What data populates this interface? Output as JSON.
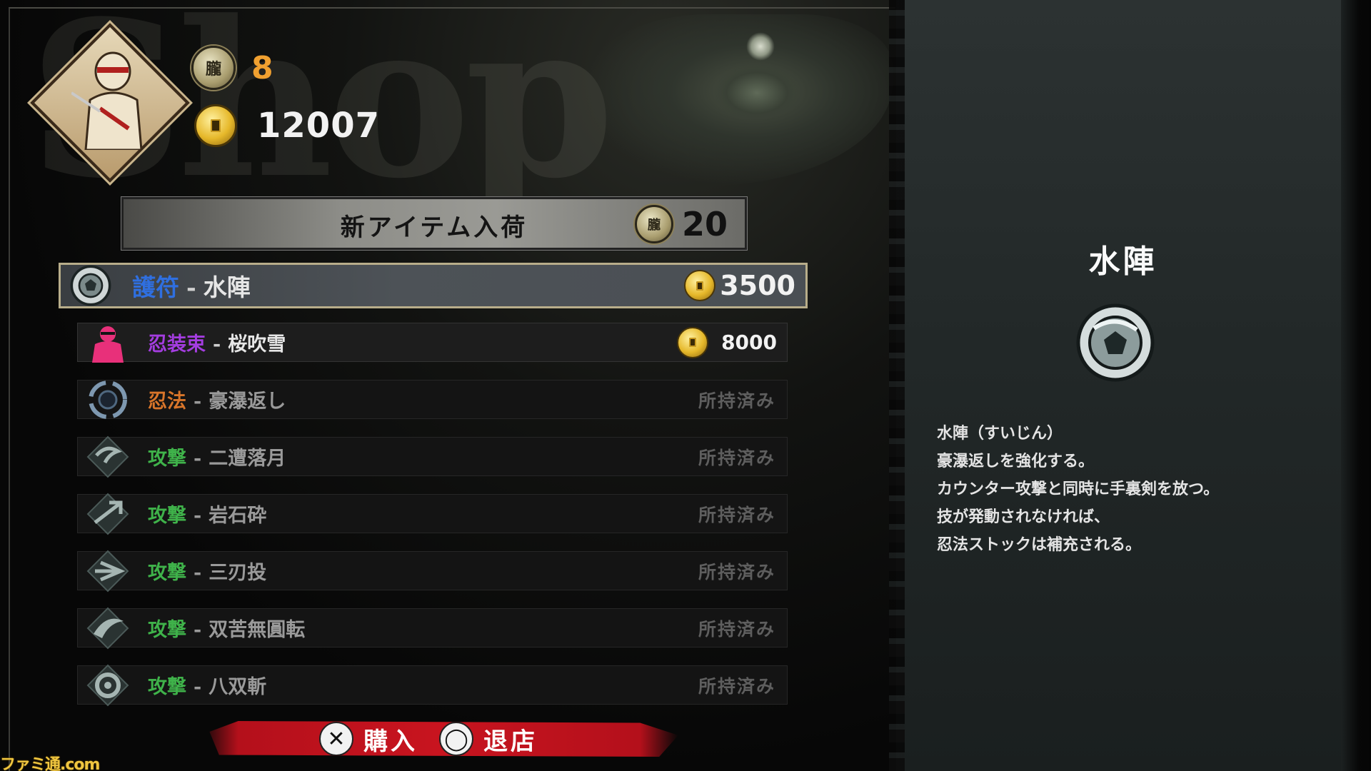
{
  "header": {
    "watermark": "Shop",
    "moon_currency": "8",
    "moon_glyph": "朧",
    "gold_currency": "12007"
  },
  "new_items": {
    "label": "新アイテム入荷",
    "cost": "20"
  },
  "items": [
    {
      "category": "護符",
      "category_color": "#2f6fe0",
      "name": "水陣",
      "price": "3500",
      "owned": false,
      "selected": true,
      "icon": "talisman-icon"
    },
    {
      "category": "忍装束",
      "category_color": "#a43de0",
      "name": "桜吹雪",
      "price": "8000",
      "owned": false,
      "selected": false,
      "icon": "ninja-outfit-icon"
    },
    {
      "category": "忍法",
      "category_color": "#d8752a",
      "name": "豪瀑返し",
      "status": "所持済み",
      "owned": true,
      "icon": "ninpo-icon"
    },
    {
      "category": "攻撃",
      "category_color": "#3fb24a",
      "name": "二遭落月",
      "status": "所持済み",
      "owned": true,
      "icon": "attack-icon"
    },
    {
      "category": "攻撃",
      "category_color": "#3fb24a",
      "name": "岩石砕",
      "status": "所持済み",
      "owned": true,
      "icon": "attack-icon"
    },
    {
      "category": "攻撃",
      "category_color": "#3fb24a",
      "name": "三刃投",
      "status": "所持済み",
      "owned": true,
      "icon": "attack-icon"
    },
    {
      "category": "攻撃",
      "category_color": "#3fb24a",
      "name": "双苦無圓転",
      "status": "所持済み",
      "owned": true,
      "icon": "attack-icon"
    },
    {
      "category": "攻撃",
      "category_color": "#3fb24a",
      "name": "八双斬",
      "status": "所持済み",
      "owned": true,
      "icon": "attack-icon"
    }
  ],
  "controls": {
    "buy_button_glyph": "✕",
    "buy_label": "購入",
    "exit_button_glyph": "◯",
    "exit_label": "退店"
  },
  "detail": {
    "title": "水陣",
    "icon": "talisman-icon",
    "description": [
      "水陣（すいじん）",
      "豪瀑返しを強化する。",
      "カウンター攻撃と同時に手裏剣を放つ。",
      "技が発動されなければ、",
      "忍法ストックは補充される。"
    ]
  },
  "brand_watermark": "ファミ通.com"
}
